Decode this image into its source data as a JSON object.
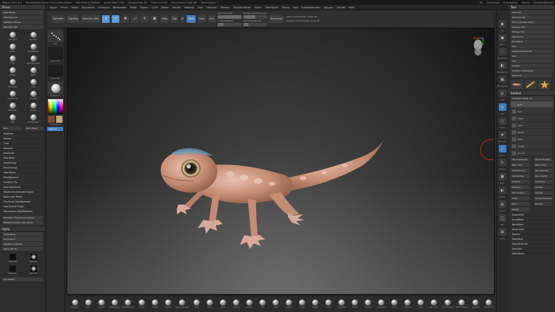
{
  "titlebar": {
    "app": "ZBrush 2021.6.5",
    "project": "Portablestop Demo: Frei Conaro Boden",
    "free_mem": "Free Mem 17.656GB",
    "active_mem": "Active Mem 1702",
    "scratch": "Scratch Disk 48",
    "timer": "Timer ▸ 0.005",
    "polycount": "PolyCount ▸ 2.444 MP",
    "meshcount": "MeshCount ▸ 1",
    "ac": "AC",
    "quicksave": "QuickSave",
    "transparency": "Transparenz",
    "menus_label": "Menüs",
    "default_script": "StandardZScript"
  },
  "menubar": [
    "Alpha",
    "Pinsel",
    "Farbe",
    "Dokument",
    "Zeichnen",
    "Bearbeiten",
    "Datei",
    "Ebene",
    "Licht",
    "Makro",
    "Marker",
    "Material",
    "Film",
    "Voreinst.",
    "Render",
    "Zeichenfläche",
    "Strich",
    "Oberfläche",
    "Textur",
    "Tool",
    "Transformieren",
    "Zplugin",
    "Zscript",
    "Hilfe"
  ],
  "toolbar": {
    "tabs": [
      "Startseite",
      "LightBox",
      "Vorschau Aktu"
    ],
    "edit": "Edit",
    "draw": "Zeichnen",
    "move": "Bewegen",
    "scale": "Skalieren",
    "rotate": "Rotieren",
    "mrgb": "Mrgb",
    "rgb": "Rgb",
    "m": "M",
    "zadd": "Zadd",
    "zsub": "Zsub",
    "zcut": "Zcut",
    "rgb_intensity": "Rgb-Intensität",
    "z_intensity": "Z-Intensität 25",
    "focal_shift": "Fokale Verschiebung 0",
    "draw_size": "Zeichengröße 64",
    "dynamic": "Dynamisch",
    "active_points": "Aktive Punktanzahl: 2,356 Mil",
    "total_points": "Gesamte Punktanzahl: 21.02 Mil"
  },
  "leftpanel": {
    "header": "Pinsel",
    "buttons": [
      "Lade Pinsel",
      "Speichern als",
      "Lightbox ▸ Pinsel",
      "Standard 190"
    ],
    "brushes": [
      "Standard",
      "Standard",
      "Move",
      "ClayBuildup",
      "Pinch",
      "DamStandard",
      "Inflate",
      "Polish",
      "Move Topo",
      "Clay",
      "Snakehook",
      "Smooth",
      "ZModeler",
      "hPolish",
      "Layer",
      "TrimDynamic",
      "Dam",
      "Flatten"
    ],
    "buttons2": [
      "Klon",
      "Nach Maus"
    ],
    "menu": [
      "Erstellen",
      "Kurven",
      "Tiefe",
      "Abstand",
      "Elemente",
      "FiberMesh",
      "Verdrehung",
      "Ausrichtung",
      "Oberfläche",
      "Modifikatoren",
      "Sculptris Pro",
      "Auto Maskieren",
      "Tablett-Druckeinstellungen",
      "Alpha und Textur",
      "Clip Brush Modifikatoren",
      "Gekrümmte Pinsel",
      "Stachelbrun Modifikatoren"
    ],
    "buttons3": [
      "Aktuellen Pinsel zurücksetzen",
      "Wiederherstellen aller Pinsel"
    ],
    "alpha_header": "Alpha",
    "alpha_buttons": [
      "Importieren",
      "Exportieren",
      "Lightbox ▸ Alphas",
      "Alpha Off  43"
    ],
    "alpha_labels": [
      "Alpha Off",
      "Alpha 01",
      "Alpha 60",
      "Alpha 02"
    ],
    "alpha_bottom": "Von Maske"
  },
  "leftcol2": {
    "thumbs": [
      "Standard",
      "Dots",
      "Alpha Off",
      "Textur Off",
      "SkinShade4"
    ],
    "switch_color": "Wechsel",
    "gradient_label": "Farbverlauf"
  },
  "viewport": {
    "navhead": "navigation-head"
  },
  "bottomshelf": [
    "Standard",
    "Move",
    "SnakeH",
    "ClayBuildup",
    "DamStandard",
    "Flatten",
    "Inflate",
    "hPolish",
    "Move Topologic",
    "Pinch",
    "Move",
    "Layer",
    "Smooth",
    "TrimDyn",
    "Trim",
    "Polish",
    "Elastic",
    "Nudge",
    "hPolish",
    "Curve",
    "ZModeler",
    "Spiral",
    "Topology",
    "SelectRect",
    "Knife",
    "Extrude",
    "Slice",
    "CurveTube",
    "CurveSurface",
    "IMM Primitives",
    "ZProject",
    "ZRemesher"
  ],
  "rightstrip": [
    "Bpr",
    "Spix 3",
    "Dynamisch",
    "Perspektive",
    "Bodengitter",
    "Lokal",
    "Sym",
    "Frame",
    "Bewegen",
    "Skalier.",
    "Rotieren",
    "PolyF",
    "Transp",
    "Ghost",
    "Solo",
    "Xpose"
  ],
  "rightpanel": {
    "header": "Tool",
    "buttons": [
      "Lade Tool",
      "Speichern als",
      "Tool von Projekt laden",
      "Kopieren Tool",
      "Einfügen Tool",
      "Importieren",
      "Exportieren",
      "Klon",
      "Erstelle PolyMesh3D",
      "GoZ",
      "Alle",
      "Sichtbar",
      "Lightbox ▸ Werkzeuge",
      "Gecko 48"
    ],
    "subtool_header": "Subtool",
    "visible_count": "Sichtbarer Zähler 10",
    "subtools": [
      "Body",
      "Eyes",
      "Claws",
      "Inner",
      "Mouth",
      "Teeth",
      "Tongue",
      "Ground"
    ],
    "list_buttons": [
      "Alle Ausklappen",
      "Alle Einklappen",
      "Nach oben",
      "Nach unten",
      "Umbenennen",
      "Auto Reorder",
      "Alle Sichtbar",
      "Alle Unsicht",
      "Duplikat",
      "Anhängen",
      "Einfügen",
      "Löschen",
      "Alle Anderen",
      "Löschen",
      "Teilen",
      "Zusammenführen",
      "Bool",
      "Remesh",
      "Projekt"
    ],
    "bottom_menu": [
      "Geometrie",
      "ArrayMesh",
      "NanoMesh",
      "Dicke Haut",
      "Ebenen",
      "FiberMesh",
      "Geometrie HD",
      "Vorschau",
      "Oberfläche"
    ]
  }
}
